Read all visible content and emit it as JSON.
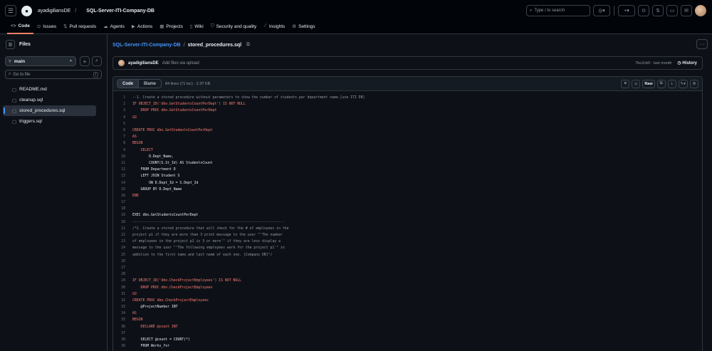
{
  "header": {
    "owner": "ayadigiliansDE",
    "separator": "/",
    "repo": "SQL-Server-ITI-Company-DB",
    "search_placeholder": "Type / to search",
    "search_key": "/"
  },
  "tabs": [
    {
      "label": "Code",
      "icon": "code-icon"
    },
    {
      "label": "Issues",
      "icon": "issue-icon"
    },
    {
      "label": "Pull requests",
      "icon": "pull-request-icon"
    },
    {
      "label": "Agents",
      "icon": "agents-icon"
    },
    {
      "label": "Actions",
      "icon": "actions-icon"
    },
    {
      "label": "Projects",
      "icon": "projects-icon"
    },
    {
      "label": "Wiki",
      "icon": "wiki-icon"
    },
    {
      "label": "Security and quality",
      "icon": "shield-icon"
    },
    {
      "label": "Insights",
      "icon": "graph-icon"
    },
    {
      "label": "Settings",
      "icon": "gear-icon"
    }
  ],
  "sidebar": {
    "title": "Files",
    "branch": "main",
    "goto_placeholder": "Go to file",
    "goto_key": "t",
    "files": [
      {
        "name": "README.md",
        "active": false
      },
      {
        "name": "cleanup.sql",
        "active": false
      },
      {
        "name": "stored_procedures.sql",
        "active": true
      },
      {
        "name": "triggers.sql",
        "active": false
      }
    ]
  },
  "breadcrumb": {
    "repo": "SQL-Server-ITI-Company-DB",
    "separator": "/",
    "file": "stored_procedures.sql"
  },
  "commit": {
    "author": "ayadigiliansDE",
    "message": "Add files via upload",
    "hash_time": "7bc2cb0 · last month",
    "history_label": "History"
  },
  "file_view": {
    "code_tab": "Code",
    "blame_tab": "Blame",
    "meta": "84 lines (71 loc) · 2.37 KB",
    "raw_label": "Raw"
  },
  "code_lines": [
    {
      "n": "1",
      "t": "--1. Create a stored procedure without parameters to show the number of students per department name.[use ITI DB]",
      "c": "cmt"
    },
    {
      "n": "2",
      "t": "IF OBJECT_ID('dbo.GetStudentsCountPerDept') IS NOT NULL",
      "c": "kw"
    },
    {
      "n": "3",
      "t": "    DROP PROC dbo.GetStudentsCountPerDept",
      "c": "kw"
    },
    {
      "n": "4",
      "t": "GO",
      "c": "kw"
    },
    {
      "n": "5",
      "t": "",
      "c": ""
    },
    {
      "n": "6",
      "t": "CREATE PROC dbo.GetStudentsCountPerDept",
      "c": "kw"
    },
    {
      "n": "7",
      "t": "AS",
      "c": "kw"
    },
    {
      "n": "8",
      "t": "BEGIN",
      "c": "kw"
    },
    {
      "n": "9",
      "t": "    SELECT",
      "c": "kw"
    },
    {
      "n": "10",
      "t": "        D.Dept_Name,",
      "c": ""
    },
    {
      "n": "11",
      "t": "        COUNT(S.St_Id) AS StudentsCount",
      "c": ""
    },
    {
      "n": "12",
      "t": "    FROM Department D",
      "c": ""
    },
    {
      "n": "13",
      "t": "    LEFT JOIN Student S",
      "c": ""
    },
    {
      "n": "14",
      "t": "        ON D.Dept_Id = S.Dept_Id",
      "c": ""
    },
    {
      "n": "15",
      "t": "    GROUP BY D.Dept_Name",
      "c": ""
    },
    {
      "n": "16",
      "t": "END",
      "c": "kw"
    },
    {
      "n": "17",
      "t": "",
      "c": ""
    },
    {
      "n": "18",
      "t": "",
      "c": ""
    },
    {
      "n": "19",
      "t": "EXEC dbo.GetStudentsCountPerDept",
      "c": ""
    },
    {
      "n": "20",
      "t": "--------------------------------------------------------------------------",
      "c": "cmt"
    },
    {
      "n": "21",
      "t": "/*2. Create a stored procedure that will check for the # of employees in the",
      "c": "cmt"
    },
    {
      "n": "22",
      "t": "project p1 if they are more than 3 print message to the user \"'The number",
      "c": "cmt"
    },
    {
      "n": "23",
      "t": "of employees in the project p1 is 3 or more'\" if they are less display a",
      "c": "cmt"
    },
    {
      "n": "24",
      "t": "message to the user \"'The following employees work for the project p1'\" in",
      "c": "cmt"
    },
    {
      "n": "25",
      "t": "addition to the first name and last name of each one. [Company DB]\"/",
      "c": "cmt"
    },
    {
      "n": "26",
      "t": "",
      "c": ""
    },
    {
      "n": "27",
      "t": "",
      "c": ""
    },
    {
      "n": "28",
      "t": "",
      "c": ""
    },
    {
      "n": "29",
      "t": "IF OBJECT_ID('dbo.CheckProjectEmployees') IS NOT NULL",
      "c": "kw"
    },
    {
      "n": "30",
      "t": "    DROP PROC dbo.CheckProjectEmployees",
      "c": "kw"
    },
    {
      "n": "31",
      "t": "GO",
      "c": "kw"
    },
    {
      "n": "32",
      "t": "CREATE PROC dbo.CheckProjectEmployees",
      "c": "kw"
    },
    {
      "n": "33",
      "t": "    @ProjectNumber INT",
      "c": ""
    },
    {
      "n": "34",
      "t": "AS",
      "c": "kw"
    },
    {
      "n": "35",
      "t": "BEGIN",
      "c": "kw"
    },
    {
      "n": "36",
      "t": "    DECLARE @count INT",
      "c": "kw"
    },
    {
      "n": "37",
      "t": "",
      "c": ""
    },
    {
      "n": "38",
      "t": "    SELECT @count = COUNT(*)",
      "c": ""
    },
    {
      "n": "39",
      "t": "    FROM Works_for",
      "c": ""
    }
  ]
}
